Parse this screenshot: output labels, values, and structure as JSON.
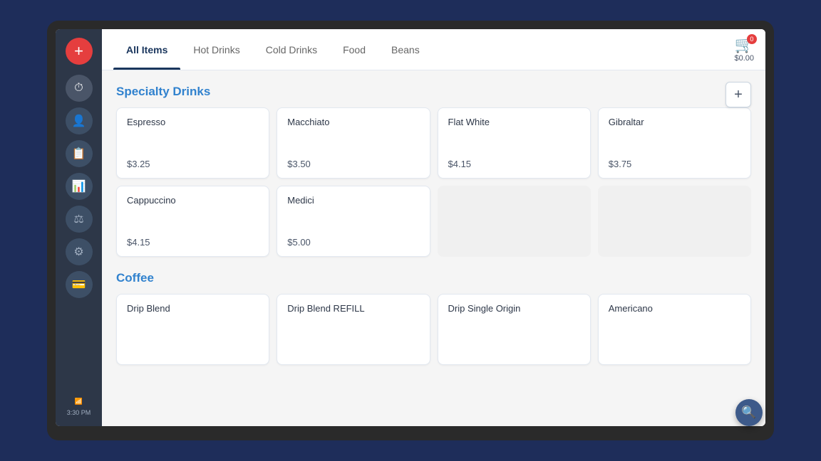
{
  "sidebar": {
    "add_icon": "+",
    "icons": [
      {
        "name": "clock-icon",
        "symbol": "⏱",
        "active": true
      },
      {
        "name": "user-icon",
        "symbol": "👤",
        "active": false
      },
      {
        "name": "orders-icon",
        "symbol": "📋",
        "active": false
      },
      {
        "name": "analytics-icon",
        "symbol": "📊",
        "active": false
      },
      {
        "name": "scale-icon",
        "symbol": "⚖",
        "active": false
      },
      {
        "name": "settings-icon",
        "symbol": "⚙",
        "active": false
      },
      {
        "name": "payment-icon",
        "symbol": "💳",
        "active": false
      }
    ],
    "wifi_symbol": "WiFi",
    "time": "3:30 PM"
  },
  "header": {
    "tabs": [
      {
        "label": "All Items",
        "active": true
      },
      {
        "label": "Hot Drinks",
        "active": false
      },
      {
        "label": "Cold Drinks",
        "active": false
      },
      {
        "label": "Food",
        "active": false
      },
      {
        "label": "Beans",
        "active": false
      }
    ],
    "cart": {
      "badge": "0",
      "total": "$0.00"
    }
  },
  "sections": [
    {
      "title": "Specialty Drinks",
      "items": [
        {
          "name": "Espresso",
          "price": "$3.25"
        },
        {
          "name": "Macchiato",
          "price": "$3.50"
        },
        {
          "name": "Flat White",
          "price": "$4.15"
        },
        {
          "name": "Gibraltar",
          "price": "$3.75"
        },
        {
          "name": "Cappuccino",
          "price": "$4.15"
        },
        {
          "name": "Medici",
          "price": "$5.00"
        },
        {
          "name": "",
          "price": ""
        },
        {
          "name": "",
          "price": ""
        }
      ]
    },
    {
      "title": "Coffee",
      "items": [
        {
          "name": "Drip Blend",
          "price": ""
        },
        {
          "name": "Drip Blend REFILL",
          "price": ""
        },
        {
          "name": "Drip Single Origin",
          "price": ""
        },
        {
          "name": "Americano",
          "price": ""
        }
      ]
    }
  ],
  "add_button_label": "+",
  "search_icon_label": "🔍"
}
